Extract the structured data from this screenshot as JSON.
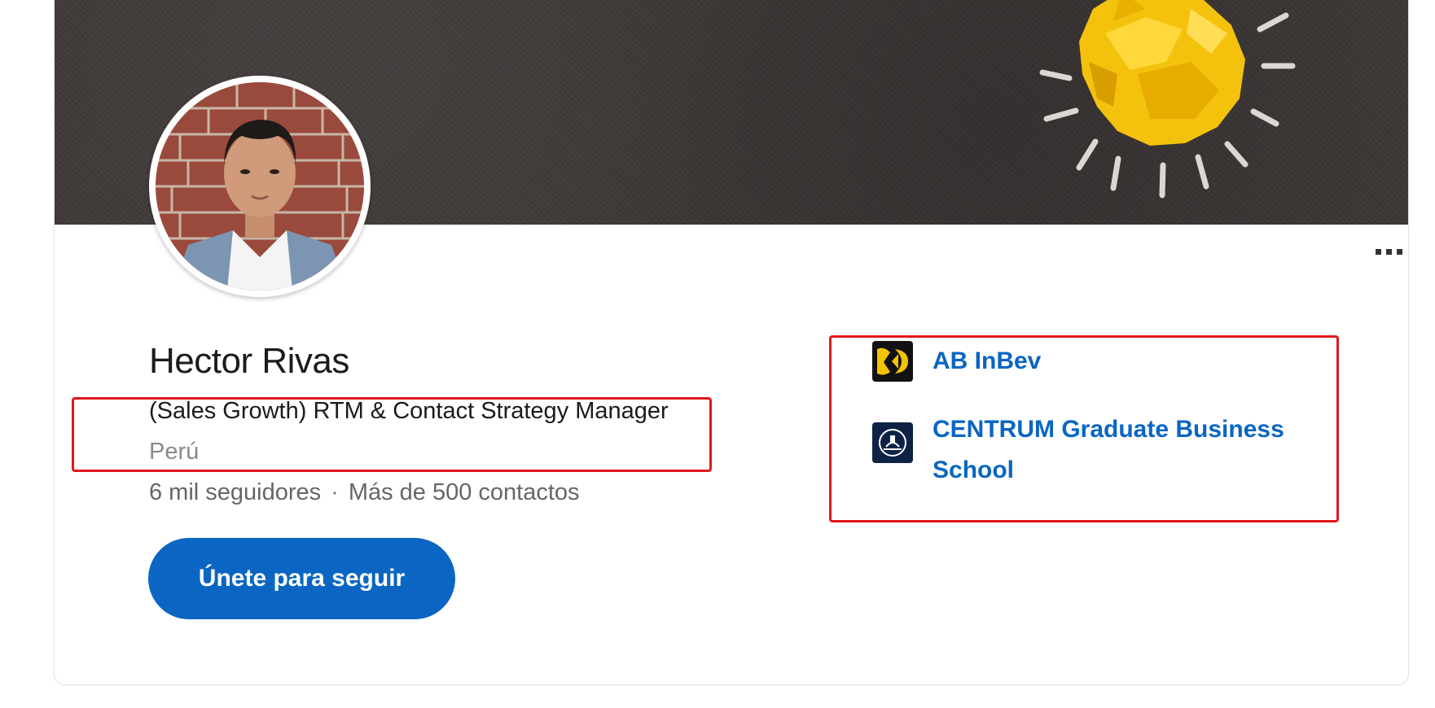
{
  "profile": {
    "name": "Hector Rivas",
    "headline": "(Sales Growth) RTM & Contact Strategy Manager",
    "location": "Perú",
    "followers": "6 mil seguidores",
    "separator": "·",
    "connections": "Más de 500 contactos",
    "follow_label": "Únete para seguir"
  },
  "companies": [
    {
      "name": "AB InBev",
      "icon": "ab-inbev-logo"
    },
    {
      "name": "CENTRUM Graduate Business School",
      "line1": "CENTRUM Graduate Business",
      "line2": "School",
      "icon": "centrum-logo"
    }
  ],
  "icons": {
    "more": "more-horizontal-icon"
  },
  "colors": {
    "accent": "#0a66c2",
    "highlight": "#e0181e",
    "cover": "#3e3837",
    "bulb_yellow": "#f4c20d"
  }
}
